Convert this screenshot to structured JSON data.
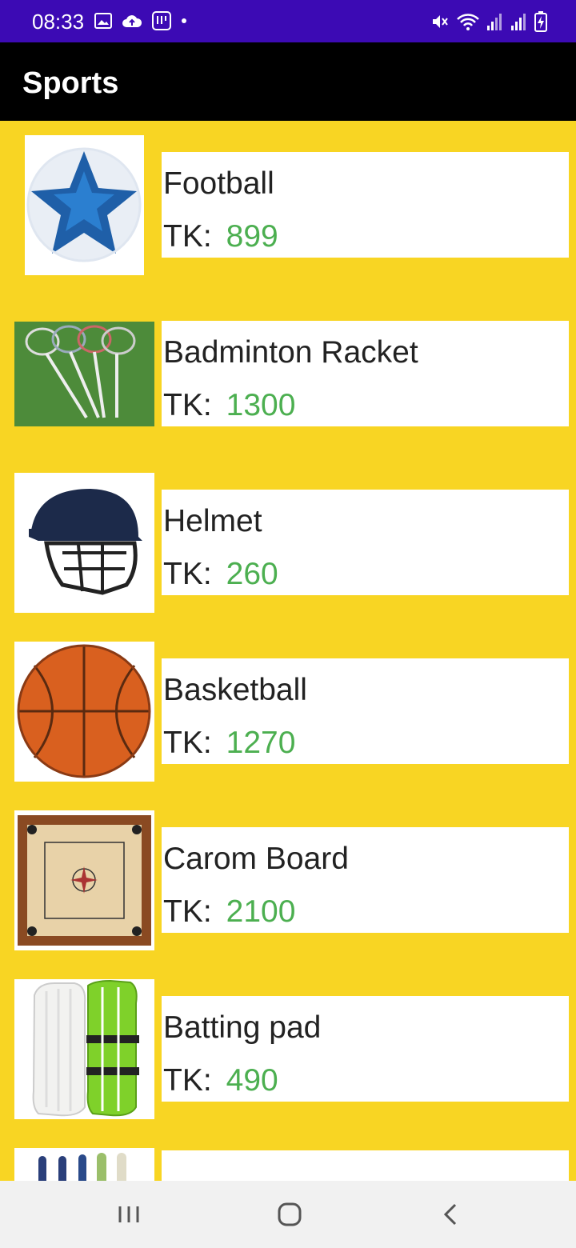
{
  "status_bar": {
    "time": "08:33",
    "icons_left": [
      "gallery-icon",
      "cloud-upload-icon",
      "voicemail-icon",
      "dot-icon"
    ],
    "icons_right": [
      "mute-icon",
      "wifi-icon",
      "signal-icon",
      "signal-icon",
      "battery-charging-icon"
    ]
  },
  "app_bar": {
    "title": "Sports"
  },
  "products": [
    {
      "name": "Football",
      "price_label": "TK:",
      "price": "899",
      "image": "football-image"
    },
    {
      "name": "Badminton Racket",
      "price_label": "TK:",
      "price": "1300",
      "image": "badminton-racket-image"
    },
    {
      "name": "Helmet",
      "price_label": "TK:",
      "price": "260",
      "image": "helmet-image"
    },
    {
      "name": "Basketball",
      "price_label": "TK:",
      "price": "1270",
      "image": "basketball-image"
    },
    {
      "name": "Carom Board",
      "price_label": "TK:",
      "price": "2100",
      "image": "carom-board-image"
    },
    {
      "name": "Batting pad",
      "price_label": "TK:",
      "price": "490",
      "image": "batting-pad-image"
    },
    {
      "name": "",
      "price_label": "",
      "price": "",
      "image": "bat-grips-image"
    }
  ],
  "nav_bar": {
    "buttons": [
      "recent-apps",
      "home",
      "back"
    ]
  },
  "colors": {
    "background": "#f8d523",
    "status_bar": "#3c0ab4",
    "app_bar": "#000000",
    "price": "#4caf50",
    "nav_bar": "#f1f1f1"
  }
}
